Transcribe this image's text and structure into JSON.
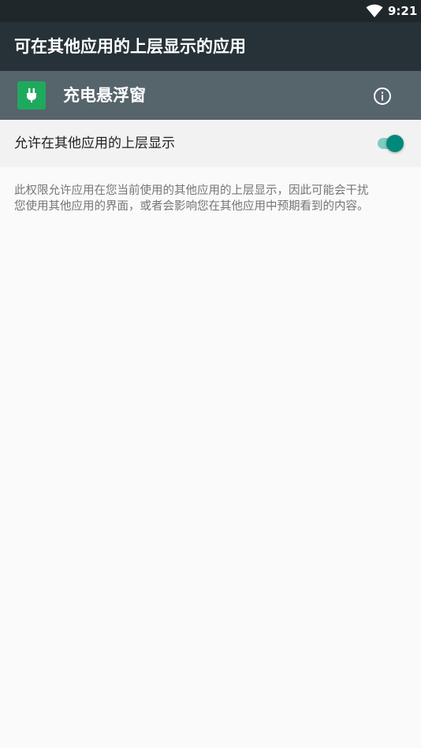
{
  "status_bar": {
    "time": "9:21",
    "wifi_icon": "wifi-icon"
  },
  "toolbar": {
    "title": "可在其他应用的上层显示的应用"
  },
  "app": {
    "name": "充电悬浮窗",
    "icon": "plug-icon",
    "icon_color": "#1fa95e",
    "info_icon": "info-icon"
  },
  "permission": {
    "label": "允许在其他应用的上层显示",
    "enabled": true,
    "accent_color": "#00897b"
  },
  "description": {
    "line1": "此权限允许应用在您当前使用的其他应用的上层显示，因此可能会干扰",
    "line2": "您使用其他应用的界面，或者会影响您在其他应用中预期看到的内容。"
  }
}
